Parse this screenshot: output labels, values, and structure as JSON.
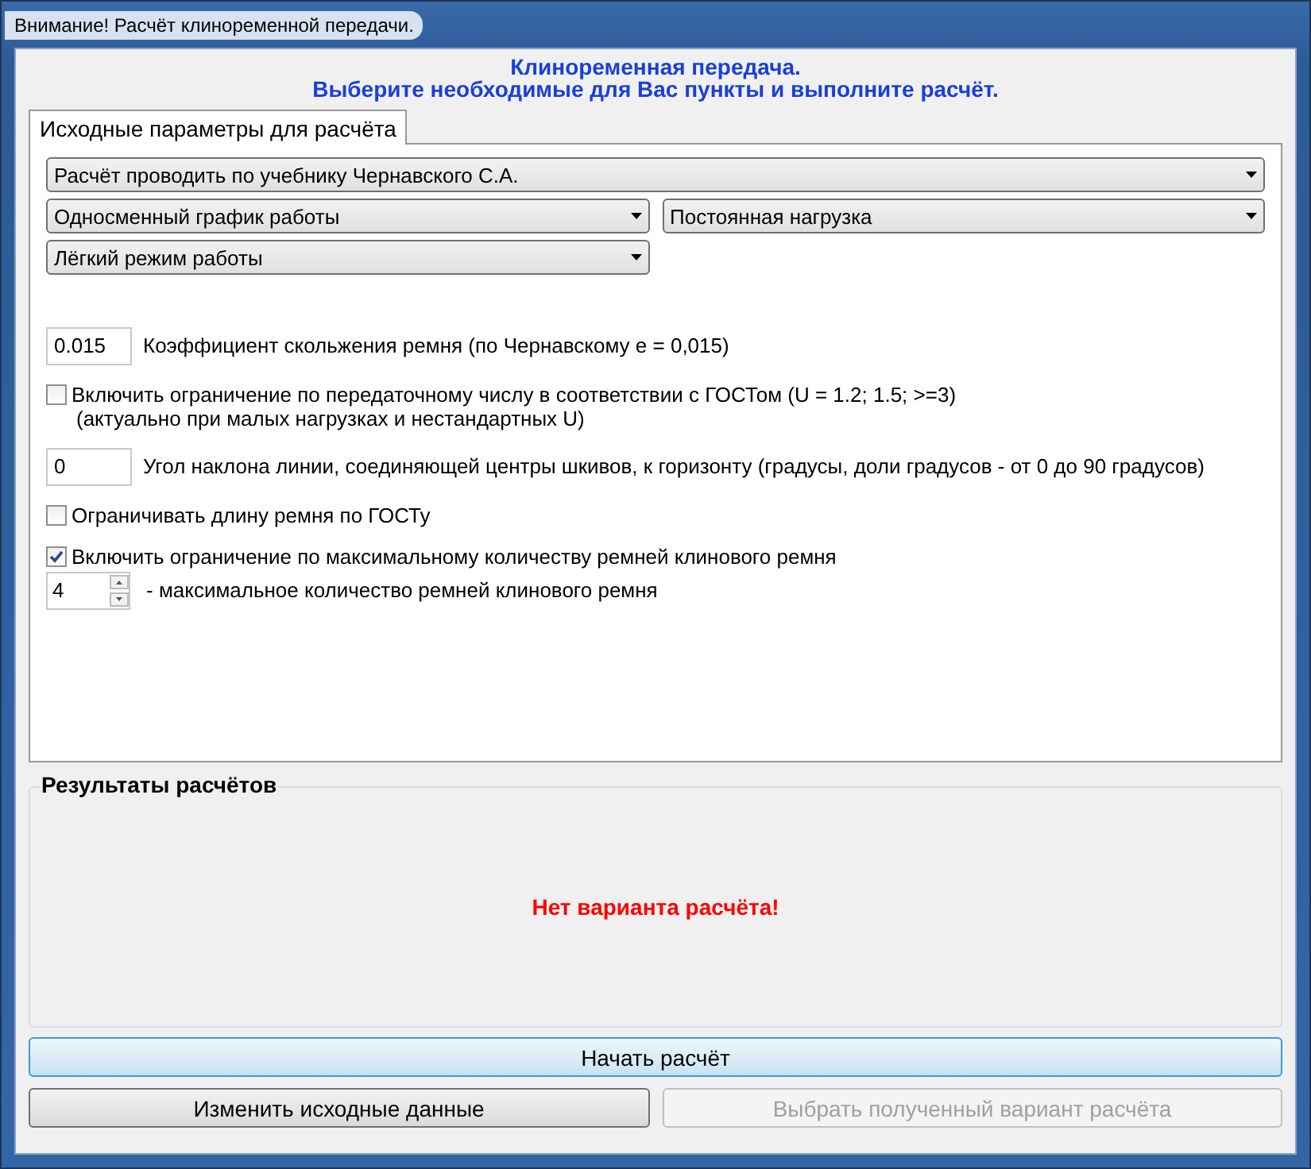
{
  "window": {
    "title": "Внимание! Расчёт клиноременной передачи."
  },
  "header": [
    "Клиноременная передача.",
    "Выберите необходимые для Вас пункты и выполните расчёт."
  ],
  "tabs": [
    {
      "label": "Исходные параметры для расчёта",
      "selected": true
    }
  ],
  "dropdown_rows": [
    [
      {
        "value": "Расчёт проводить по учебнику Чернавского С.А."
      }
    ],
    [
      {
        "value": "Односменный график работы"
      },
      {
        "value": "Постоянная нагрузка"
      }
    ],
    [
      {
        "value": "Лёгкий режим работы"
      }
    ]
  ],
  "options": [
    {
      "kind": "field",
      "value": "0.015",
      "description": "Коэффициент скольжения ремня (по Чернавскому е = 0,015)"
    },
    {
      "kind": "checkbox",
      "checked": false,
      "label": "Включить ограничение по передаточному числу в соответствии с ГОСТом (U = 1.2; 1.5; >=3)",
      "note": "(актуально при малых нагрузках и нестандартных U)"
    },
    {
      "kind": "field",
      "value": "0",
      "description": "Угол наклона линии, соединяющей центры шкивов, к горизонту (градусы, доли градусов - от 0 до 90 градусов)"
    },
    {
      "kind": "checkbox",
      "checked": false,
      "label": "Ограничивать длину ремня по ГОСТу"
    },
    {
      "kind": "checkbox",
      "checked": true,
      "label": "Включить ограничение по максимальному количеству ремней клинового ремня"
    },
    {
      "kind": "spinner",
      "value": "4",
      "description": "- максимальное количество ремней клинового ремня"
    }
  ],
  "results": {
    "title": "Результаты расчётов",
    "message": "Нет варианта расчёта!"
  },
  "start_button": {
    "label": "Начать расчёт",
    "disabled": false
  },
  "buttons": [
    {
      "label": "Изменить исходные данные",
      "disabled": false
    },
    {
      "label": "Выбрать полученный вариант расчёта",
      "disabled": true
    }
  ]
}
